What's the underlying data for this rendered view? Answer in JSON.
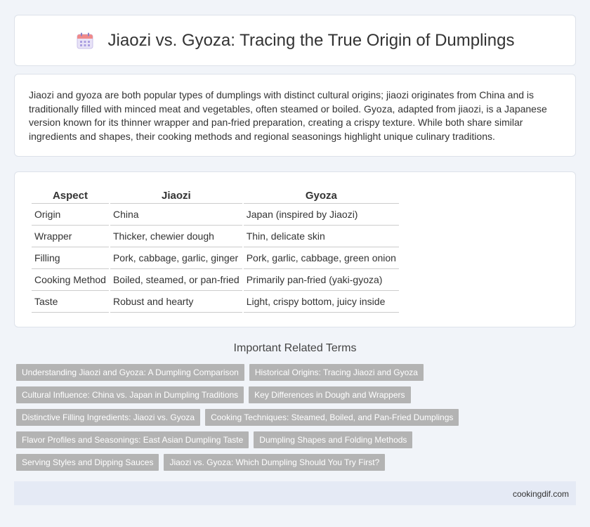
{
  "header": {
    "icon": "calendar-icon",
    "title": "Jiaozi vs. Gyoza: Tracing the True Origin of Dumplings"
  },
  "intro": {
    "text": "Jiaozi and gyoza are both popular types of dumplings with distinct cultural origins; jiaozi originates from China and is traditionally filled with minced meat and vegetables, often steamed or boiled. Gyoza, adapted from jiaozi, is a Japanese version known for its thinner wrapper and pan-fried preparation, creating a crispy texture. While both share similar ingredients and shapes, their cooking methods and regional seasonings highlight unique culinary traditions."
  },
  "table": {
    "headers": [
      "Aspect",
      "Jiaozi",
      "Gyoza"
    ],
    "rows": [
      [
        "Origin",
        "China",
        "Japan (inspired by Jiaozi)"
      ],
      [
        "Wrapper",
        "Thicker, chewier dough",
        "Thin, delicate skin"
      ],
      [
        "Filling",
        "Pork, cabbage, garlic, ginger",
        "Pork, garlic, cabbage, green onion"
      ],
      [
        "Cooking Method",
        "Boiled, steamed, or pan-fried",
        "Primarily pan-fried (yaki-gyoza)"
      ],
      [
        "Taste",
        "Robust and hearty",
        "Light, crispy bottom, juicy inside"
      ]
    ]
  },
  "related": {
    "title": "Important Related Terms",
    "tags": [
      "Understanding Jiaozi and Gyoza: A Dumpling Comparison",
      "Historical Origins: Tracing Jiaozi and Gyoza",
      "Cultural Influence: China vs. Japan in Dumpling Traditions",
      "Key Differences in Dough and Wrappers",
      "Distinctive Filling Ingredients: Jiaozi vs. Gyoza",
      "Cooking Techniques: Steamed, Boiled, and Pan-Fried Dumplings",
      "Flavor Profiles and Seasonings: East Asian Dumpling Taste",
      "Dumpling Shapes and Folding Methods",
      "Serving Styles and Dipping Sauces",
      "Jiaozi vs. Gyoza: Which Dumpling Should You Try First?"
    ]
  },
  "footer": {
    "site": "cookingdif.com"
  }
}
